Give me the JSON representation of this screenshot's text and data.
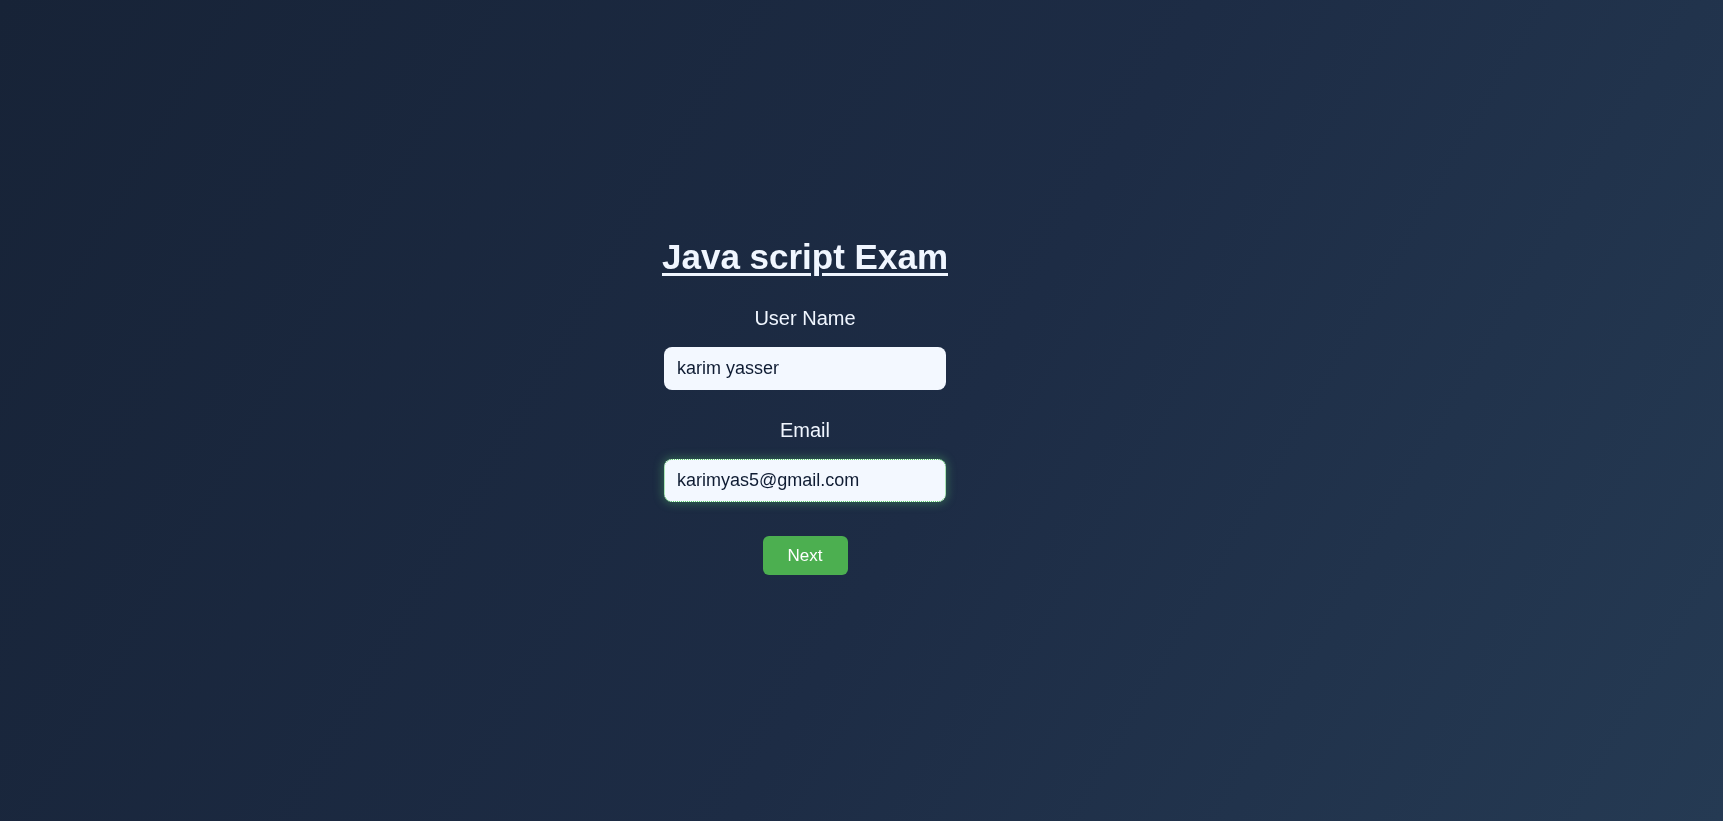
{
  "form": {
    "title": "Java script Exam",
    "fields": [
      {
        "label": "User Name",
        "value": "karim yasser",
        "focused": false
      },
      {
        "label": "Email",
        "value": "karimyas5@gmail.com",
        "focused": true
      }
    ],
    "submit_button": "Next"
  }
}
